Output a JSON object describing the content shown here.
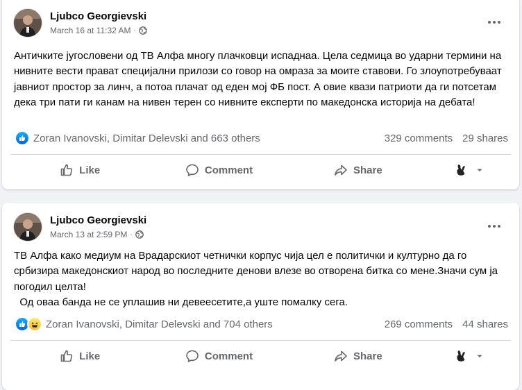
{
  "posts": [
    {
      "author": "Ljubco Georgievski",
      "timestamp": "March 16 at 11:32 AM",
      "separator": "·",
      "text": "Античките југословени од ТВ Алфа многу плачковци испаднаа. Цела седмица во ударни термини на нивните вести прават специјални прилози со говор на омраза за моите ставови. Го злоупотребуваат јавниот простор за линч, а потоа плачат од еден мој ФБ пост. А овие квази патриоти да ги потсетам дека три пати ги канам на нивен терен со нивните експерти по македонска историја на дебата!",
      "reactions": [
        "like"
      ],
      "reactors": "Zoran Ivanovski, Dimitar Delevski and 663 others",
      "comments": "329 comments",
      "shares": "29 shares",
      "actions": {
        "like": "Like",
        "comment": "Comment",
        "share": "Share"
      }
    },
    {
      "author": "Ljubco Georgievski",
      "timestamp": "March 13 at 2:59 PM",
      "separator": "·",
      "text": "ТВ Алфа како медиум на Врадарскиот четнички корпус чија цел е политички и културно да го србизира македонскиот народ во последните денови влезе во отворена битка со мене.Значи сум ја погодил целта!\n  Од оваа банда не се уплашив ни девеесетите,а уште помалку сега.",
      "reactions": [
        "like",
        "haha"
      ],
      "reactors": "Zoran Ivanovski, Dimitar Delevski and 704 others",
      "comments": "269 comments",
      "shares": "44 shares",
      "actions": {
        "like": "Like",
        "comment": "Comment",
        "share": "Share"
      }
    }
  ],
  "colors": {
    "background": "#f0f2f5",
    "card": "#ffffff",
    "secondary_text": "#65676b",
    "like_blue": "#0062df",
    "haha_yellow": "#f5c33b"
  },
  "icons": {
    "privacy": "globe-icon",
    "more": "more-options-icon",
    "like": "thumbs-up-icon",
    "comment": "speech-bubble-icon",
    "share": "share-arrow-icon",
    "profile_switch": "profile-avatar-icon"
  }
}
